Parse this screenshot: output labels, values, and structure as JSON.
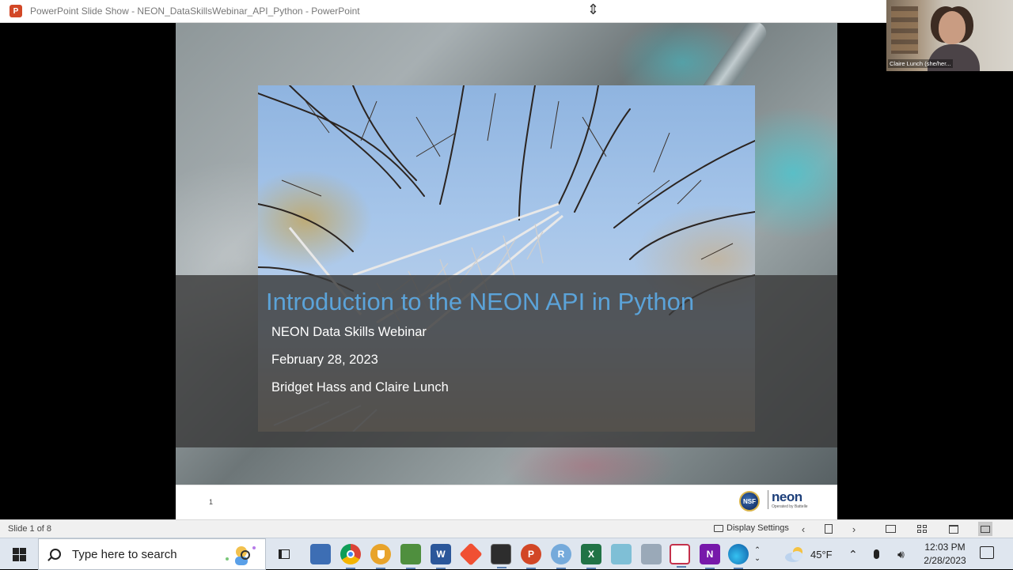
{
  "window": {
    "title": "PowerPoint Slide Show  -  NEON_DataSkillsWebinar_API_Python - PowerPoint",
    "app_icon": "P"
  },
  "webcam": {
    "name": "Claire Lunch (she/her..."
  },
  "slide": {
    "title": "Introduction to the NEON API in Python",
    "subtitle_lines": [
      "NEON Data Skills Webinar",
      "February 28, 2023",
      "Bridget Hass and Claire Lunch"
    ],
    "page_number": "1",
    "logo_text": "neon",
    "logo_tagline": "Operated by Battelle",
    "nsf_text": "NSF"
  },
  "statusbar": {
    "slide_counter": "Slide 1 of 8",
    "display_settings_label": "Display Settings"
  },
  "taskbar": {
    "search_placeholder": "Type here to search",
    "weather": "45°F",
    "time": "12:03 PM",
    "date": "2/28/2023",
    "apps": [
      {
        "name": "task-view-icon",
        "label": ""
      },
      {
        "name": "remote-app-icon",
        "label": ""
      },
      {
        "name": "chrome-icon",
        "label": ""
      },
      {
        "name": "vpn-shield-icon",
        "label": ""
      },
      {
        "name": "image-viewer-icon",
        "label": ""
      },
      {
        "name": "word-icon",
        "label": "W"
      },
      {
        "name": "git-icon",
        "label": ""
      },
      {
        "name": "terminal-icon",
        "label": ""
      },
      {
        "name": "powerpoint-icon",
        "label": "P"
      },
      {
        "name": "r-icon",
        "label": "R"
      },
      {
        "name": "excel-icon",
        "label": "X"
      },
      {
        "name": "notes-icon",
        "label": ""
      },
      {
        "name": "mail-icon",
        "label": ""
      },
      {
        "name": "snipping-icon",
        "label": ""
      },
      {
        "name": "onenote-icon",
        "label": "N"
      },
      {
        "name": "edge-icon",
        "label": ""
      }
    ]
  }
}
